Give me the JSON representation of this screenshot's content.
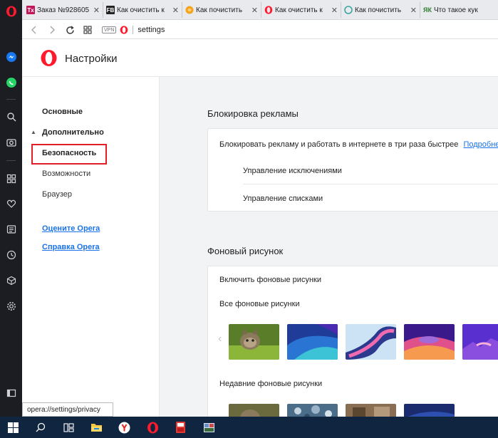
{
  "tabs": [
    {
      "title": "Заказ №928605",
      "favicon": "tx-icon",
      "fav_text": "Tx"
    },
    {
      "title": "Как очистить к",
      "favicon": "fb-icon",
      "fav_text": "FB"
    },
    {
      "title": "Как почистить",
      "favicon": "orange-circle-icon",
      "fav_text": ""
    },
    {
      "title": "Как очистить к",
      "favicon": "opera-icon",
      "fav_text": ""
    },
    {
      "title": "Как почистить",
      "favicon": "teal-circle-icon",
      "fav_text": ""
    },
    {
      "title": "Что такое кук",
      "favicon": "yak-icon",
      "fav_text": "ЯК"
    }
  ],
  "tab_close_glyph": "✕",
  "address": {
    "vpn_label": "VPN",
    "url": "settings"
  },
  "header": {
    "title": "Настройки"
  },
  "nav": {
    "basic": "Основные",
    "advanced_arrow": "▲",
    "advanced": "Дополнительно",
    "security": "Безопасность",
    "features": "Возможности",
    "browser": "Браузер",
    "rate_opera": "Оцените Opera",
    "help_opera": "Справка Opera"
  },
  "adblock": {
    "title": "Блокировка рекламы",
    "description": "Блокировать рекламу и работать в интернете в три раза быстрее",
    "more_link": "Подробнее...",
    "exceptions": "Управление исключениями",
    "lists": "Управление списками"
  },
  "wallpapers": {
    "title": "Фоновый рисунок",
    "enable": "Включить фоновые рисунки",
    "all": "Все фоновые рисунки",
    "recent": "Недавние фоновые рисунки",
    "prev_glyph": "‹"
  },
  "status_url": "opera://settings/privacy",
  "colors": {
    "accent": "#1a73e8",
    "highlight": "#e21f26",
    "opera_red": "#ff1b2d"
  }
}
